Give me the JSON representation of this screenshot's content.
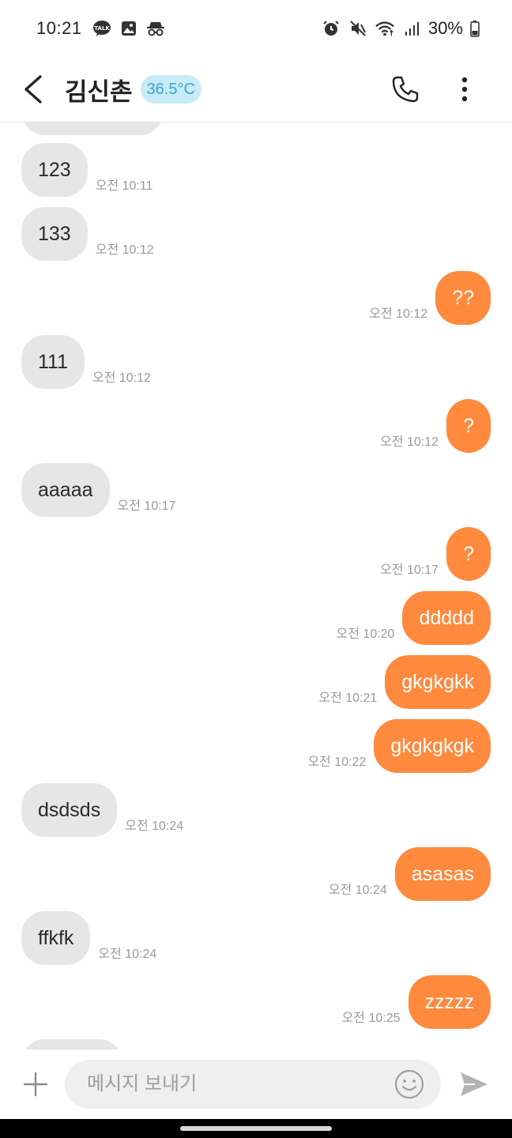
{
  "status_bar": {
    "time": "10:21",
    "battery_text": "30%",
    "left_icons": [
      "kakaotalk-icon",
      "gallery-icon",
      "incognito-icon"
    ],
    "right_icons": [
      "alarm-icon",
      "mute-icon",
      "wifi-icon",
      "signal-icon",
      "battery-icon"
    ]
  },
  "header": {
    "contact_name": "김신촌",
    "temperature": "36.5°C",
    "accent_color": "#ff8a3d",
    "badge_color": "#c8ebf7"
  },
  "messages": [
    {
      "dir": "in",
      "text": "123",
      "time": "오전 10:11"
    },
    {
      "dir": "in",
      "text": "133",
      "time": "오전 10:12"
    },
    {
      "dir": "out",
      "text": "??",
      "time": "오전 10:12"
    },
    {
      "dir": "in",
      "text": "111",
      "time": "오전 10:12"
    },
    {
      "dir": "out",
      "text": "?",
      "time": "오전 10:12"
    },
    {
      "dir": "in",
      "text": "aaaaa",
      "time": "오전 10:17"
    },
    {
      "dir": "out",
      "text": "?",
      "time": "오전 10:17"
    },
    {
      "dir": "out",
      "text": "ddddd",
      "time": "오전 10:20"
    },
    {
      "dir": "out",
      "text": "gkgkgkk",
      "time": "오전 10:21"
    },
    {
      "dir": "out",
      "text": "gkgkgkgk",
      "time": "오전 10:22"
    },
    {
      "dir": "in",
      "text": "dsdsds",
      "time": "오전 10:24"
    },
    {
      "dir": "out",
      "text": "asasas",
      "time": "오전 10:24"
    },
    {
      "dir": "in",
      "text": "ffkfk",
      "time": "오전 10:24"
    },
    {
      "dir": "out",
      "text": "zzzzz",
      "time": "오전 10:25"
    }
  ],
  "input": {
    "placeholder": "메시지 보내기",
    "value": ""
  }
}
